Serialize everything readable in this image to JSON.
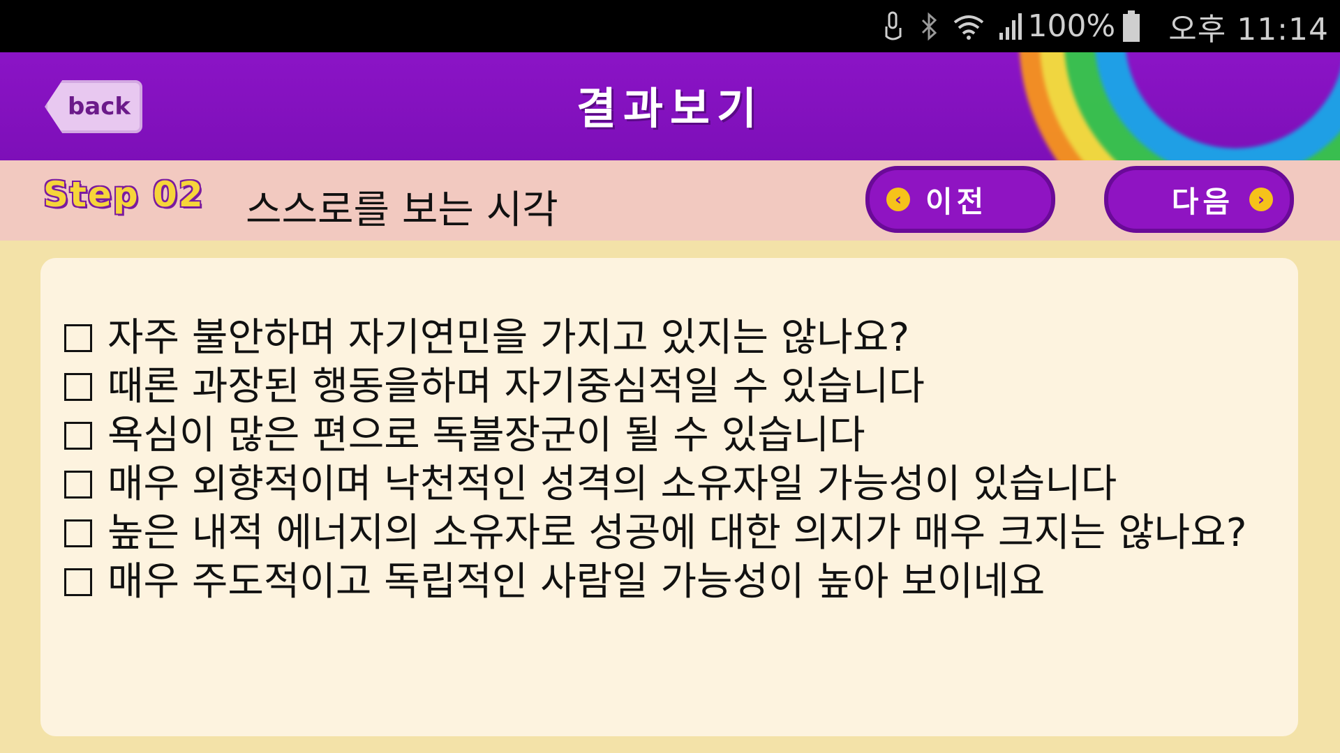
{
  "status_bar": {
    "battery_text": "100%",
    "time": "오후 11:14",
    "icons": [
      "touch-icon",
      "bluetooth-icon",
      "wifi-icon",
      "signal-icon",
      "battery-icon"
    ]
  },
  "header": {
    "back_label": "back",
    "title": "결과보기"
  },
  "step": {
    "label": "Step 02",
    "title": "스스로를 보는 시각",
    "prev_label": "이전",
    "next_label": "다음"
  },
  "checklist": {
    "items": [
      "자주 불안하며 자기연민을 가지고 있지는 않나요?",
      "때론 과장된 행동을하며 자기중심적일 수 있습니다",
      "욕심이 많은 편으로 독불장군이 될 수 있습니다",
      "매우 외향적이며 낙천적인 성격의 소유자일 가능성이 있습니다",
      "높은 내적 에너지의 소유자로 성공에 대한 의지가 매우 크지는 않나요?",
      "매우 주도적이고 독립적인 사람일 가능성이 높아 보이네요"
    ]
  },
  "colors": {
    "header_purple": "#8b14c6",
    "step_bar_pink": "#f2c9c0",
    "page_background": "#f3e2a8",
    "content_background": "#fdf3df",
    "arrow_yellow": "#f6c21a"
  }
}
